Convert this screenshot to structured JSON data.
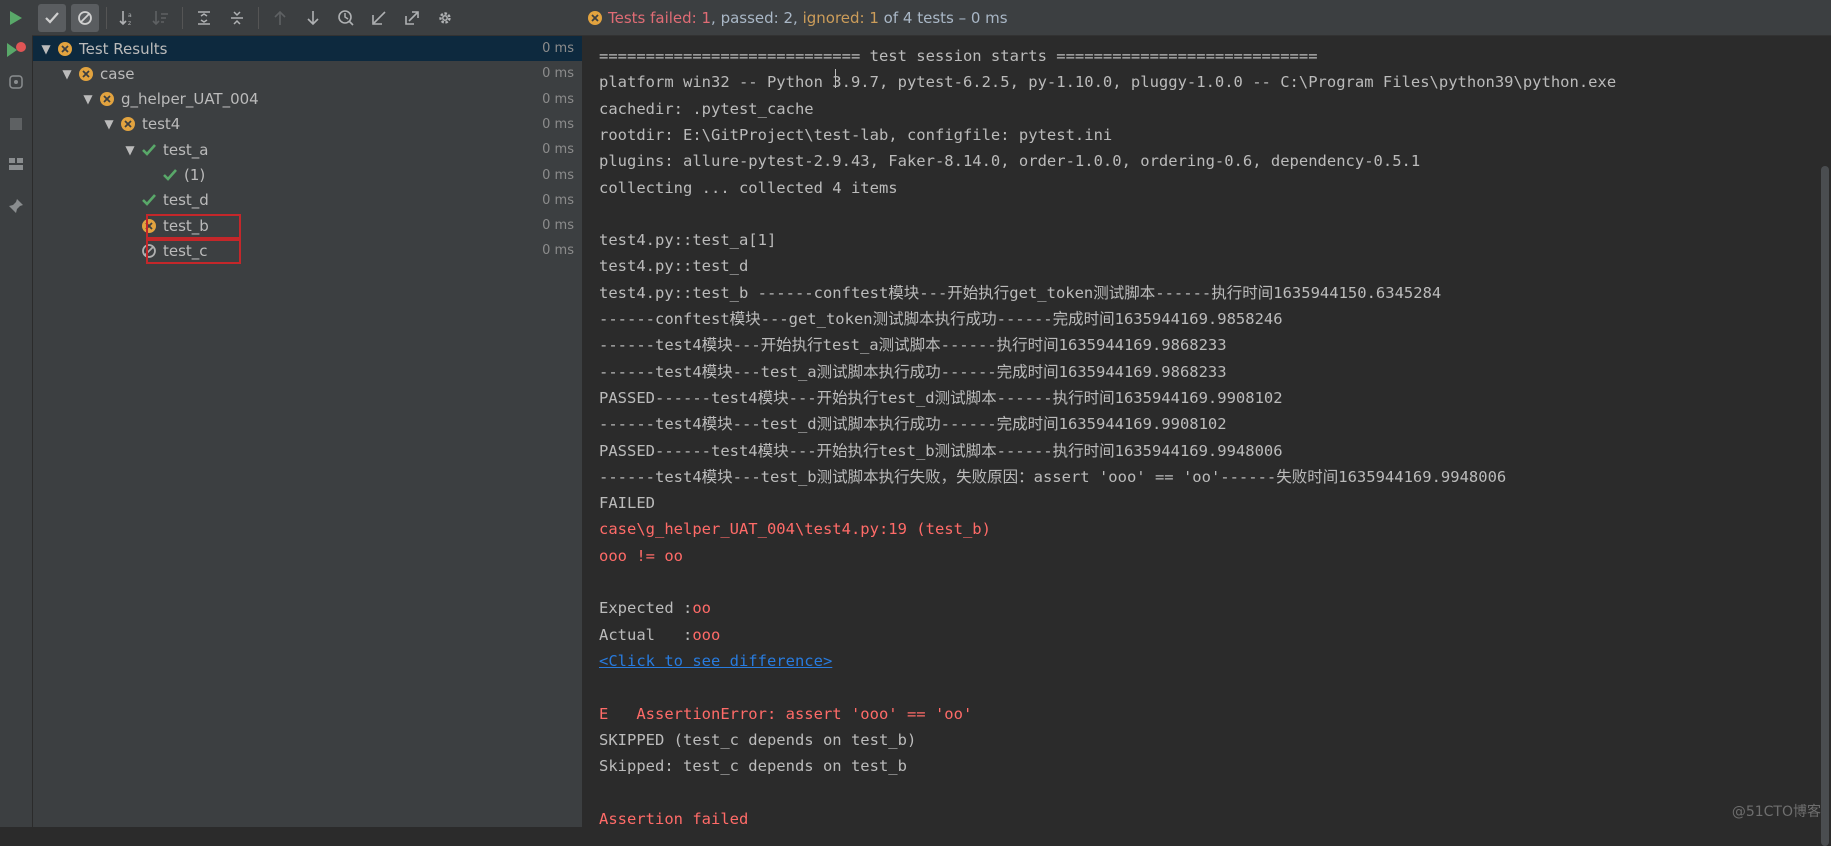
{
  "toolbar": {
    "buttons": [
      "run-icon",
      "show-passed-icon",
      "show-ignored-icon",
      "sort-alpha-icon",
      "sort-duration-icon",
      "expand-all-icon",
      "collapse-all-icon",
      "prev-failed-icon",
      "next-failed-icon",
      "history-icon",
      "import-tests-icon",
      "export-tests-icon",
      "settings-icon"
    ]
  },
  "leftbar": {
    "buttons": [
      "run-icon",
      "rerun-failed-icon",
      "toggle-auto-test-icon",
      "stop-icon",
      "layout-icon",
      "pin-icon"
    ]
  },
  "status": {
    "failed_label": "Tests failed: 1",
    "passed_label": ", passed: 2, ",
    "ignored_label": "ignored: 1",
    "total_label": " of 4 tests – 0 ms"
  },
  "tree": [
    {
      "label": "Test Results",
      "time": "0 ms",
      "status": "failed",
      "depth": 0,
      "expanded": true
    },
    {
      "label": "case",
      "time": "0 ms",
      "status": "failed",
      "depth": 1,
      "expanded": true
    },
    {
      "label": "g_helper_UAT_004",
      "time": "0 ms",
      "status": "failed",
      "depth": 2,
      "expanded": true
    },
    {
      "label": "test4",
      "time": "0 ms",
      "status": "failed",
      "depth": 3,
      "expanded": true
    },
    {
      "label": "test_a",
      "time": "0 ms",
      "status": "passed",
      "depth": 4,
      "expanded": true
    },
    {
      "label": "(1)",
      "time": "0 ms",
      "status": "passed",
      "depth": 5,
      "expanded": false
    },
    {
      "label": "test_d",
      "time": "0 ms",
      "status": "passed",
      "depth": 4,
      "expanded": false
    },
    {
      "label": "test_b",
      "time": "0 ms",
      "status": "failed",
      "depth": 4,
      "expanded": false
    },
    {
      "label": "test_c",
      "time": "0 ms",
      "status": "ignored",
      "depth": 4,
      "expanded": false
    }
  ],
  "console": {
    "lines": [
      "============================ test session starts ============================",
      "platform win32 -- Python 3.9.7, pytest-6.2.5, py-1.10.0, pluggy-1.0.0 -- C:\\Program Files\\python39\\python.exe",
      "cachedir: .pytest_cache",
      "rootdir: E:\\GitProject\\test-lab, configfile: pytest.ini",
      "plugins: allure-pytest-2.9.43, Faker-8.14.0, order-1.0.0, ordering-0.6, dependency-0.5.1",
      "collecting ... collected 4 items",
      "",
      "test4.py::test_a[1]",
      "test4.py::test_d",
      "test4.py::test_b ------conftest模块---开始执行get_token测试脚本------执行时间1635944150.6345284",
      "------conftest模块---get_token测试脚本执行成功------完成时间1635944169.9858246",
      "------test4模块---开始执行test_a测试脚本------执行时间1635944169.9868233",
      "------test4模块---test_a测试脚本执行成功------完成时间1635944169.9868233",
      "PASSED------test4模块---开始执行test_d测试脚本------执行时间1635944169.9908102",
      "------test4模块---test_d测试脚本执行成功------完成时间1635944169.9908102",
      "PASSED------test4模块---开始执行test_b测试脚本------执行时间1635944169.9948006",
      "------test4模块---test_b测试脚本执行失败，失败原因：assert 'ooo' == 'oo'------失败时间1635944169.9948006",
      "FAILED",
      "case\\g_helper_UAT_004\\test4.py:19 (test_b)",
      "ooo != oo",
      "",
      "Expected :",
      "Actual   :",
      "<Click to see difference>",
      "",
      "E   AssertionError: assert 'ooo' == 'oo'",
      "SKIPPED (test_c depends on test_b)",
      "Skipped: test_c depends on test_b",
      "",
      "Assertion failed"
    ],
    "expected_value": "oo",
    "actual_value": "ooo"
  },
  "watermark": "@51CTO博客",
  "colors": {
    "fail": "#e06c75",
    "pass": "#59a869",
    "ignored": "#cc9d5a",
    "link": "#287bde"
  }
}
